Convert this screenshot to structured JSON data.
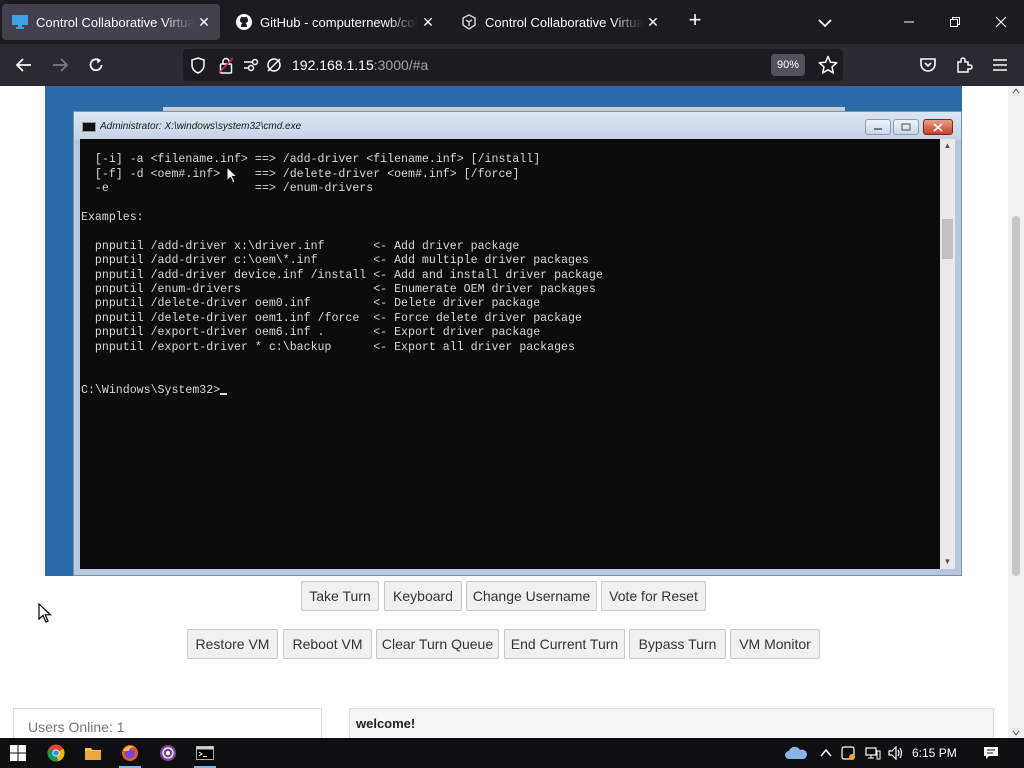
{
  "browser": {
    "tabs": [
      {
        "title": "Control Collaborative Virtual Machines",
        "active": true
      },
      {
        "title": "GitHub - computernewb/collab-vm",
        "active": false
      },
      {
        "title": "Control Collaborative Virtual Machines",
        "active": false
      }
    ],
    "url_host": "192.168.1.15",
    "url_path": ":3000/#a",
    "zoom": "90%"
  },
  "vm": {
    "cmd_title": "Administrator: X:\\windows\\system32\\cmd.exe",
    "console_lines": [
      "  [-i] -a <filename.inf> ==> /add-driver <filename.inf> [/install]",
      "  [-f] -d <oem#.inf>     ==> /delete-driver <oem#.inf> [/force]",
      "  -e                     ==> /enum-drivers",
      "",
      "Examples:",
      "",
      "  pnputil /add-driver x:\\driver.inf       <- Add driver package",
      "  pnputil /add-driver c:\\oem\\*.inf        <- Add multiple driver packages",
      "  pnputil /add-driver device.inf /install <- Add and install driver package",
      "  pnputil /enum-drivers                   <- Enumerate OEM driver packages",
      "  pnputil /delete-driver oem0.inf         <- Delete driver package",
      "  pnputil /delete-driver oem1.inf /force  <- Force delete driver package",
      "  pnputil /export-driver oem6.inf .       <- Export driver package",
      "  pnputil /export-driver * c:\\backup      <- Export all driver packages",
      "",
      ""
    ],
    "prompt": "C:\\Windows\\System32>"
  },
  "controls": {
    "row1": [
      "Take Turn",
      "Keyboard",
      "Change Username",
      "Vote for Reset"
    ],
    "row2": [
      "Restore VM",
      "Reboot VM",
      "Clear Turn Queue",
      "End Current Turn",
      "Bypass Turn",
      "VM Monitor"
    ]
  },
  "users_online": "Users Online: 1",
  "chat": {
    "first_message": "welcome!"
  },
  "taskbar": {
    "time": "6:15 PM",
    "apps": [
      "windows-start",
      "chrome",
      "file-explorer",
      "firefox",
      "tor-browser",
      "command-prompt"
    ]
  },
  "colors": {
    "vm_bg": "#2b6aa9",
    "browser_chrome": "#1c1b22",
    "console_bg": "#0c0c0c"
  }
}
